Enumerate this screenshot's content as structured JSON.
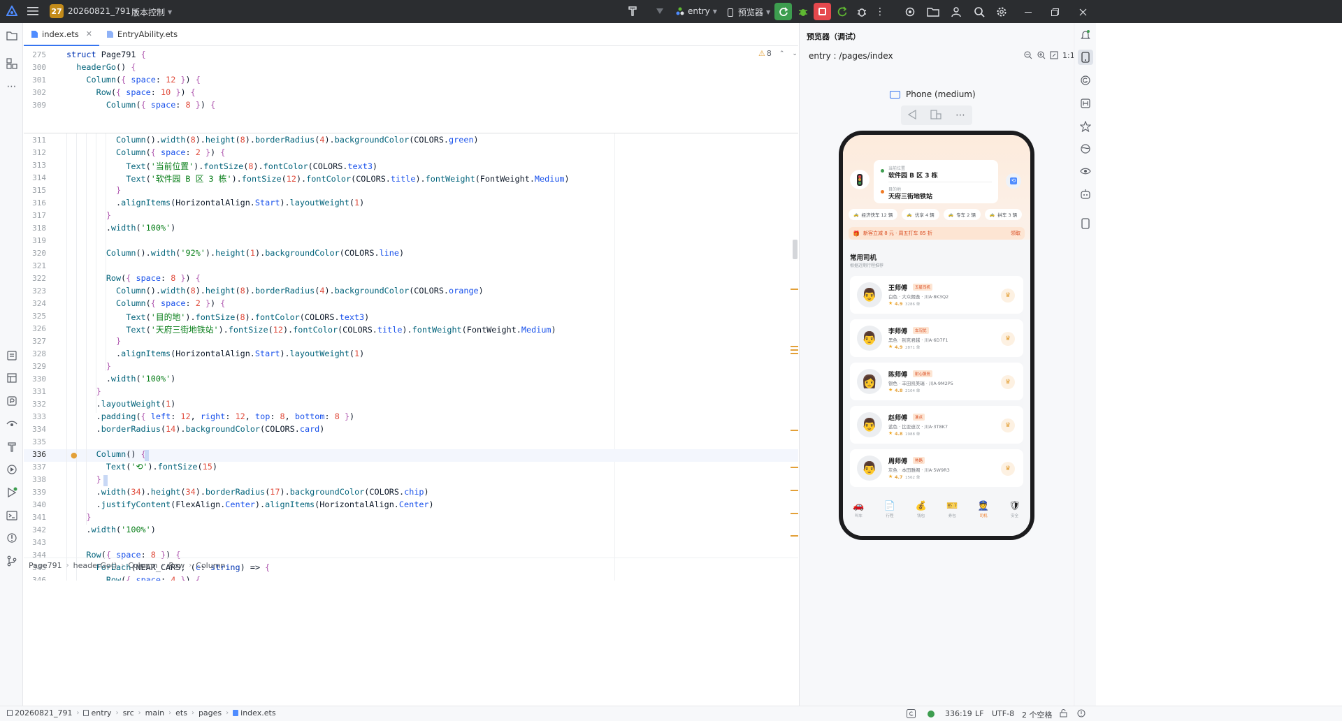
{
  "titlebar": {
    "project_badge": "27",
    "project_name": "20260821_791",
    "vcs_label": "版本控制",
    "run_config": "entry",
    "device": "预览器"
  },
  "editor": {
    "tabs": [
      {
        "label": "index.ets",
        "active": true
      },
      {
        "label": "EntryAbility.ets",
        "active": false
      }
    ],
    "warnings_count": "8",
    "sticky_lines": [
      {
        "n": "275",
        "html": "<span class='kw'>struct</span> <span class='id'>Page791</span> <span class='br'>{</span>"
      },
      {
        "n": "300",
        "html": "  <span class='fn'>headerGo</span>() <span class='br'>{</span>"
      },
      {
        "n": "301",
        "html": "    <span class='fn'>Column</span>(<span class='br'>{</span> <span class='prop'>space</span>: <span class='num'>12</span> <span class='br'>}</span>) <span class='br'>{</span>"
      },
      {
        "n": "302",
        "html": "      <span class='fn'>Row</span>(<span class='br'>{</span> <span class='prop'>space</span>: <span class='num'>10</span> <span class='br'>}</span>) <span class='br'>{</span>"
      },
      {
        "n": "309",
        "html": "        <span class='fn'>Column</span>(<span class='br'>{</span> <span class='prop'>space</span>: <span class='num'>8</span> <span class='br'>}</span>) <span class='br'>{</span>"
      }
    ],
    "lines": [
      {
        "n": "311",
        "html": "          <span class='fn'>Column</span>().<span class='fn'>width</span>(<span class='num'>8</span>).<span class='fn'>height</span>(<span class='num'>8</span>).<span class='fn'>borderRadius</span>(<span class='num'>4</span>).<span class='fn'>backgroundColor</span>(COLORS.<span class='prop'>green</span>)"
      },
      {
        "n": "312",
        "html": "          <span class='fn'>Column</span>(<span class='br'>{</span> <span class='prop'>space</span>: <span class='num'>2</span> <span class='br'>}</span>) <span class='br'>{</span>"
      },
      {
        "n": "313",
        "html": "            <span class='fn'>Text</span>(<span class='str'>'当前位置'</span>).<span class='fn'>fontSize</span>(<span class='num'>8</span>).<span class='fn'>fontColor</span>(COLORS.<span class='prop'>text3</span>)"
      },
      {
        "n": "314",
        "html": "            <span class='fn'>Text</span>(<span class='str'>'软件园 B 区 3 栋'</span>).<span class='fn'>fontSize</span>(<span class='num'>12</span>).<span class='fn'>fontColor</span>(COLORS.<span class='prop'>title</span>).<span class='fn'>fontWeight</span>(FontWeight.<span class='prop'>Medium</span>)"
      },
      {
        "n": "315",
        "html": "          <span class='br'>}</span>"
      },
      {
        "n": "316",
        "html": "          .<span class='fn'>alignItems</span>(HorizontalAlign.<span class='prop'>Start</span>).<span class='fn'>layoutWeight</span>(<span class='num'>1</span>)"
      },
      {
        "n": "317",
        "html": "        <span class='br'>}</span>"
      },
      {
        "n": "318",
        "html": "        .<span class='fn'>width</span>(<span class='str'>'100%'</span>)"
      },
      {
        "n": "319",
        "html": ""
      },
      {
        "n": "320",
        "html": "        <span class='fn'>Column</span>().<span class='fn'>width</span>(<span class='str'>'92%'</span>).<span class='fn'>height</span>(<span class='num'>1</span>).<span class='fn'>backgroundColor</span>(COLORS.<span class='prop'>line</span>)"
      },
      {
        "n": "321",
        "html": ""
      },
      {
        "n": "322",
        "html": "        <span class='fn'>Row</span>(<span class='br'>{</span> <span class='prop'>space</span>: <span class='num'>8</span> <span class='br'>}</span>) <span class='br'>{</span>"
      },
      {
        "n": "323",
        "html": "          <span class='fn'>Column</span>().<span class='fn'>width</span>(<span class='num'>8</span>).<span class='fn'>height</span>(<span class='num'>8</span>).<span class='fn'>borderRadius</span>(<span class='num'>4</span>).<span class='fn'>backgroundColor</span>(COLORS.<span class='prop'>orange</span>)"
      },
      {
        "n": "324",
        "html": "          <span class='fn'>Column</span>(<span class='br'>{</span> <span class='prop'>space</span>: <span class='num'>2</span> <span class='br'>}</span>) <span class='br'>{</span>"
      },
      {
        "n": "325",
        "html": "            <span class='fn'>Text</span>(<span class='str'>'目的地'</span>).<span class='fn'>fontSize</span>(<span class='num'>8</span>).<span class='fn'>fontColor</span>(COLORS.<span class='prop'>text3</span>)"
      },
      {
        "n": "326",
        "html": "            <span class='fn'>Text</span>(<span class='str'>'天府三街地铁站'</span>).<span class='fn'>fontSize</span>(<span class='num'>12</span>).<span class='fn'>fontColor</span>(COLORS.<span class='prop'>title</span>).<span class='fn'>fontWeight</span>(FontWeight.<span class='prop'>Medium</span>)"
      },
      {
        "n": "327",
        "html": "          <span class='br'>}</span>"
      },
      {
        "n": "328",
        "html": "          .<span class='fn'>alignItems</span>(HorizontalAlign.<span class='prop'>Start</span>).<span class='fn'>layoutWeight</span>(<span class='num'>1</span>)"
      },
      {
        "n": "329",
        "html": "        <span class='br'>}</span>"
      },
      {
        "n": "330",
        "html": "        .<span class='fn'>width</span>(<span class='str'>'100%'</span>)"
      },
      {
        "n": "331",
        "html": "      <span class='br'>}</span>"
      },
      {
        "n": "332",
        "html": "      .<span class='fn'>layoutWeight</span>(<span class='num'>1</span>)"
      },
      {
        "n": "333",
        "html": "      .<span class='fn'>padding</span>(<span class='br'>{</span> <span class='prop'>left</span>: <span class='num'>12</span>, <span class='prop'>right</span>: <span class='num'>12</span>, <span class='prop'>top</span>: <span class='num'>8</span>, <span class='prop'>bottom</span>: <span class='num'>8</span> <span class='br'>}</span>)"
      },
      {
        "n": "334",
        "html": "      .<span class='fn'>borderRadius</span>(<span class='num'>14</span>).<span class='fn'>backgroundColor</span>(COLORS.<span class='prop'>card</span>)"
      },
      {
        "n": "335",
        "html": ""
      },
      {
        "n": "336",
        "html": "      <span class='fn'>Column</span>() <span class='br'>{</span>"
      },
      {
        "n": "337",
        "html": "        <span class='fn'>Text</span>(<span class='str'>'⟲'</span>).<span class='fn'>fontSize</span>(<span class='num'>15</span>)"
      },
      {
        "n": "338",
        "html": "      <span class='br'>}</span>"
      },
      {
        "n": "339",
        "html": "      .<span class='fn'>width</span>(<span class='num'>34</span>).<span class='fn'>height</span>(<span class='num'>34</span>).<span class='fn'>borderRadius</span>(<span class='num'>17</span>).<span class='fn'>backgroundColor</span>(COLORS.<span class='prop'>chip</span>)"
      },
      {
        "n": "340",
        "html": "      .<span class='fn'>justifyContent</span>(FlexAlign.<span class='prop'>Center</span>).<span class='fn'>alignItems</span>(HorizontalAlign.<span class='prop'>Center</span>)"
      },
      {
        "n": "341",
        "html": "    <span class='br'>}</span>"
      },
      {
        "n": "342",
        "html": "    .<span class='fn'>width</span>(<span class='str'>'100%'</span>)"
      },
      {
        "n": "343",
        "html": ""
      },
      {
        "n": "344",
        "html": "    <span class='fn'>Row</span>(<span class='br'>{</span> <span class='prop'>space</span>: <span class='num'>8</span> <span class='br'>}</span>) <span class='br'>{</span>"
      },
      {
        "n": "345",
        "html": "      <span class='fn'>ForEach</span>(NEAR_CARS, (<span class='prop'>c</span>: <span class='kw'>string</span>) => <span class='br'>{</span>"
      },
      {
        "n": "346",
        "html": "        <span class='fn'>Row</span>(<span class='br'>{</span> <span class='prop'>space</span>: <span class='num'>4</span> <span class='br'>}</span>) <span class='br'>{</span>"
      }
    ],
    "breadcrumb": [
      "Page791",
      "headerGo()",
      "Column",
      "Row",
      "Column"
    ]
  },
  "preview": {
    "title": "预览器（调试）",
    "route": "entry : /pages/index",
    "zoom_label": "1:1",
    "device_name": "Phone (medium)"
  },
  "app": {
    "loc_cur_label": "当前位置",
    "loc_cur": "软件园 B 区 3 栋",
    "loc_dest_label": "目的地",
    "loc_dest": "天府三街地铁站",
    "chips": [
      "经济快车 12 辆",
      "优享 4 辆",
      "专车 2 辆",
      "拼车 3 辆"
    ],
    "promo": "新客立减 8 元 · 周五打车 85 折",
    "promo_action": "领取",
    "section_title": "常用司机",
    "section_sub": "根据近期行程推荐",
    "drivers": [
      {
        "name": "王师傅",
        "tag": "五星司机",
        "car": "白色 · 大众朗逸 · 川A·8K3Q2",
        "rating": "4.9",
        "trips": "3286 单",
        "avatar": "👨"
      },
      {
        "name": "李师傅",
        "tag": "车况优",
        "car": "黑色 · 别克君越 · 川A·6D7F1",
        "rating": "4.9",
        "trips": "2871 单",
        "avatar": "👨"
      },
      {
        "name": "陈师傅",
        "tag": "耐心服务",
        "car": "银色 · 丰田凯美瑞 · 川A·9M2P5",
        "rating": "4.8",
        "trips": "2104 单",
        "avatar": "👩"
      },
      {
        "name": "赵师傅",
        "tag": "准点",
        "car": "蓝色 · 比亚迪汉 · 川A·3T8K7",
        "rating": "4.8",
        "trips": "1988 单",
        "avatar": "👨"
      },
      {
        "name": "周师傅",
        "tag": "熟路",
        "car": "灰色 · 本田雅阁 · 川A·5W9R3",
        "rating": "4.7",
        "trips": "1562 单",
        "avatar": "👨"
      }
    ],
    "nav": [
      {
        "label": "叫车",
        "icon": "🚗",
        "active": false
      },
      {
        "label": "行程",
        "icon": "📄",
        "active": false
      },
      {
        "label": "钱包",
        "icon": "💰",
        "active": false
      },
      {
        "label": "券包",
        "icon": "🎫",
        "active": false
      },
      {
        "label": "司机",
        "icon": "👮",
        "active": true
      },
      {
        "label": "安全",
        "icon": "🛡",
        "active": false
      }
    ]
  },
  "statusbar": {
    "path": [
      "20260821_791",
      "entry",
      "src",
      "main",
      "ets",
      "pages",
      "index.ets"
    ],
    "position": "336:19",
    "line_sep": "LF",
    "encoding": "UTF-8",
    "indent": "2 个空格"
  }
}
